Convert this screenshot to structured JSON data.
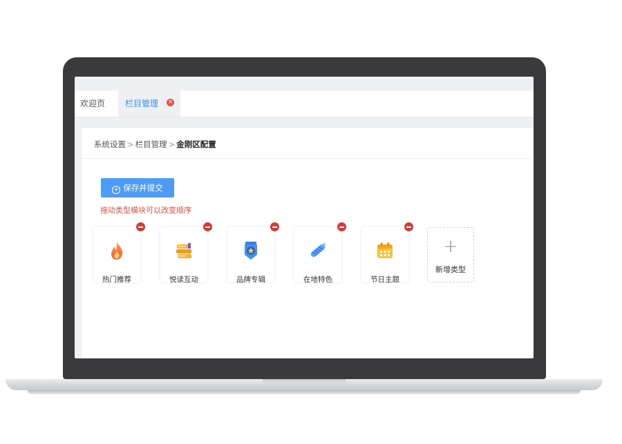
{
  "tabs": [
    {
      "label": "欢迎页",
      "active": false
    },
    {
      "label": "栏目管理",
      "active": true,
      "close_icon": "close-icon"
    }
  ],
  "breadcrumb": {
    "items": [
      "系统设置",
      "栏目管理"
    ],
    "separator": ">",
    "current": "金刚区配置"
  },
  "toolbar": {
    "save_label": "保存并提交",
    "save_icon": "plus-circle-icon"
  },
  "hint": "拖动类型模块可以改变顺序",
  "categories": [
    {
      "label": "热门推荐",
      "icon": "fire-icon"
    },
    {
      "label": "悦读互动",
      "icon": "books-icon"
    },
    {
      "label": "品牌专辑",
      "icon": "badge-icon"
    },
    {
      "label": "在地特色",
      "icon": "rope-icon"
    },
    {
      "label": "节日主题",
      "icon": "calendar-icon"
    }
  ],
  "add_card": {
    "label": "新增类型",
    "icon": "plus-icon"
  },
  "colors": {
    "accent": "#4d9bf7",
    "danger": "#d93838",
    "hint": "#e5534b",
    "laptop_bezel": "#3a3a3c"
  }
}
